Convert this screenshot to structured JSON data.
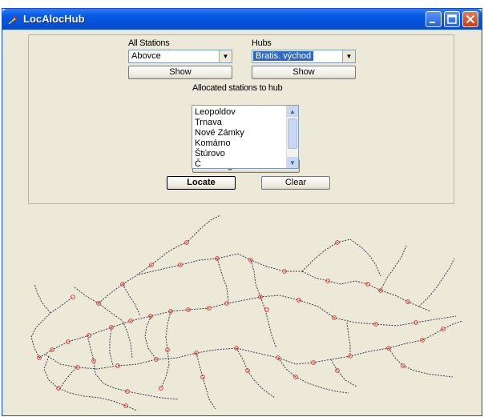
{
  "window": {
    "title": "LocAlocHub",
    "colors": {
      "titlebar": "#0a5ce6",
      "face": "#ece9d8",
      "map_lines": "#3c3c4a",
      "hubs": "#e43a3a"
    }
  },
  "stations": {
    "label": "All Stations",
    "selected": "Abovce",
    "show_label": "Show"
  },
  "hubs": {
    "label": "Hubs",
    "selected": "Bratis. východ",
    "show_label": "Show"
  },
  "allocated": {
    "label": "Allocated stations to hub",
    "items": [
      "Leopoldov",
      "Trnava",
      "Nové Zámky",
      "Komárno",
      "Štúrovo",
      "Č"
    ]
  },
  "change_params_label": "Change Parameters",
  "locate_label": "Locate",
  "clear_label": "Clear"
}
